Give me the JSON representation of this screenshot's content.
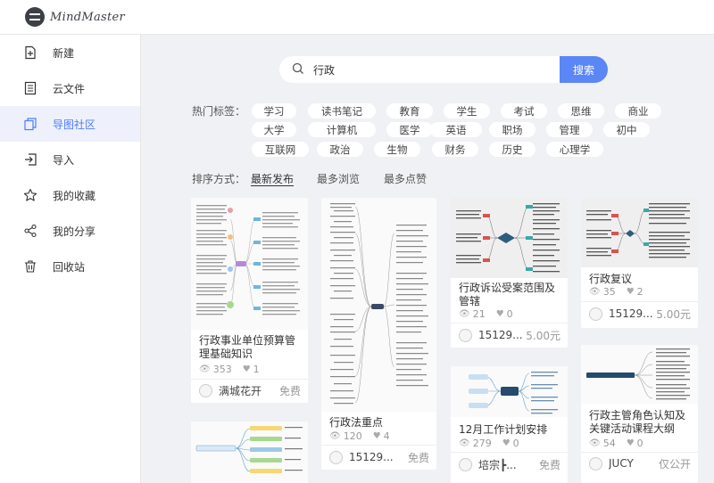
{
  "app": {
    "logo_text": "MindMaster"
  },
  "sidebar": {
    "items": [
      {
        "label": "新建",
        "icon": "new-file-icon"
      },
      {
        "label": "云文件",
        "icon": "cloud-file-icon"
      },
      {
        "label": "导图社区",
        "icon": "community-icon",
        "active": true
      },
      {
        "label": "导入",
        "icon": "import-icon"
      },
      {
        "label": "我的收藏",
        "icon": "star-icon"
      },
      {
        "label": "我的分享",
        "icon": "share-icon"
      },
      {
        "label": "回收站",
        "icon": "trash-icon"
      }
    ]
  },
  "search": {
    "value": "行政",
    "placeholder": "",
    "button": "搜索"
  },
  "hot_tags": {
    "label": "热门标签：",
    "tags": [
      "学习",
      "读书笔记",
      "教育",
      "学生",
      "考试",
      "思维",
      "商业",
      "大学",
      "计算机",
      "医学",
      "英语",
      "职场",
      "管理",
      "初中",
      "互联网",
      "政治",
      "生物",
      "财务",
      "历史",
      "心理学"
    ]
  },
  "sort": {
    "label": "排序方式：",
    "options": [
      "最新发布",
      "最多浏览",
      "最多点赞"
    ],
    "active": "最新发布"
  },
  "cards": [
    {
      "title": "行政事业单位预算管理基础知识",
      "views": "353",
      "likes": "1",
      "author": "满城花开",
      "price": "免费"
    },
    {
      "title": "行政法重点",
      "views": "120",
      "likes": "4",
      "author": "15129...",
      "price": "免费"
    },
    {
      "title": "行政诉讼受案范围及管辖",
      "views": "21",
      "likes": "0",
      "author": "15129...",
      "price": "5.00元"
    },
    {
      "title": "12月工作计划安排",
      "views": "279",
      "likes": "0",
      "author": "培宗┣...",
      "price": "免费"
    },
    {
      "title": "行政复议",
      "views": "35",
      "likes": "2",
      "author": "15129...",
      "price": "5.00元"
    },
    {
      "title": "行政主管角色认知及关键活动课程大纲",
      "views": "54",
      "likes": "0",
      "author": "JUCY",
      "price": "仅公开"
    },
    {
      "title": "",
      "views": "",
      "likes": "",
      "author": "",
      "price": ""
    }
  ],
  "colors": {
    "accent": "#5b86f6",
    "active_bg": "#eef1fb",
    "page_bg": "#f0f1f4"
  }
}
